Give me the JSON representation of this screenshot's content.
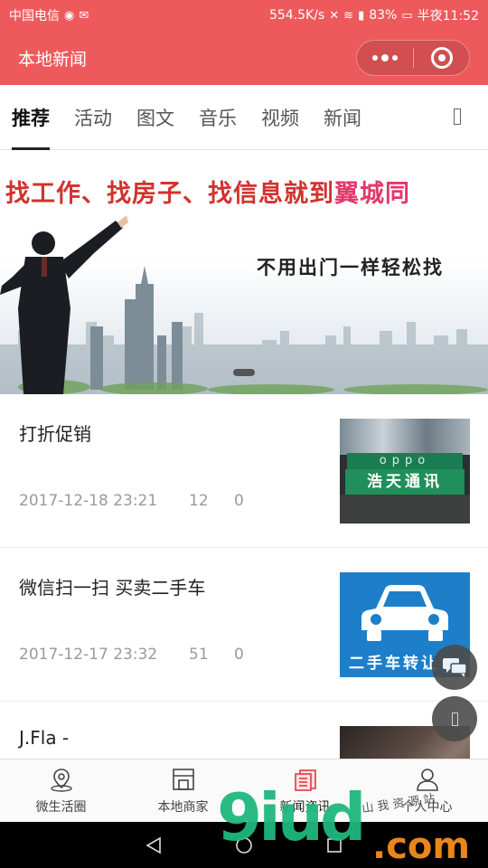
{
  "status_bar": {
    "carrier": "中国电信",
    "speed": "554.5K/s",
    "battery": "83%",
    "time": "半夜11:52",
    "icons": [
      "weibo-icon",
      "wechat-icon",
      "mute-icon",
      "wifi-icon",
      "signal-icon",
      "battery-icon"
    ]
  },
  "nav": {
    "title": "本地新闻"
  },
  "tabs": [
    {
      "label": "推荐",
      "active": true
    },
    {
      "label": "活动"
    },
    {
      "label": "图文"
    },
    {
      "label": "音乐"
    },
    {
      "label": "视频"
    },
    {
      "label": "新闻"
    }
  ],
  "banner": {
    "line1_prefix": "找工作、找房子、找信息就到",
    "line1_brand": "翼城同",
    "line2": "不用出门一样轻松找"
  },
  "news": [
    {
      "title": "打折促销",
      "date": "2017-12-18 23:21",
      "views": "12",
      "comments": "0",
      "thumb_logo": "oppo",
      "thumb_sign": "浩天通讯"
    },
    {
      "title": "微信扫一扫 买卖二手车",
      "date": "2017-12-17 23:32",
      "views": "51",
      "comments": "0",
      "thumb_text": "二手车转让"
    },
    {
      "title": "J.Fla -"
    }
  ],
  "tabbar": [
    {
      "label": "微生活圈",
      "icon": "location-icon"
    },
    {
      "label": "本地商家",
      "icon": "store-icon"
    },
    {
      "label": "新闻资讯",
      "icon": "news-icon",
      "active": true
    },
    {
      "label": "个人中心",
      "icon": "user-icon"
    }
  ],
  "watermark": {
    "main": "9iud",
    "suffix": ".com",
    "tagline": "山 我 资 源 站"
  },
  "colors": {
    "header": "#ee5a5c",
    "accent": "#e4393c",
    "watermark_green": "#1fb87f",
    "watermark_orange": "#e8861c"
  }
}
